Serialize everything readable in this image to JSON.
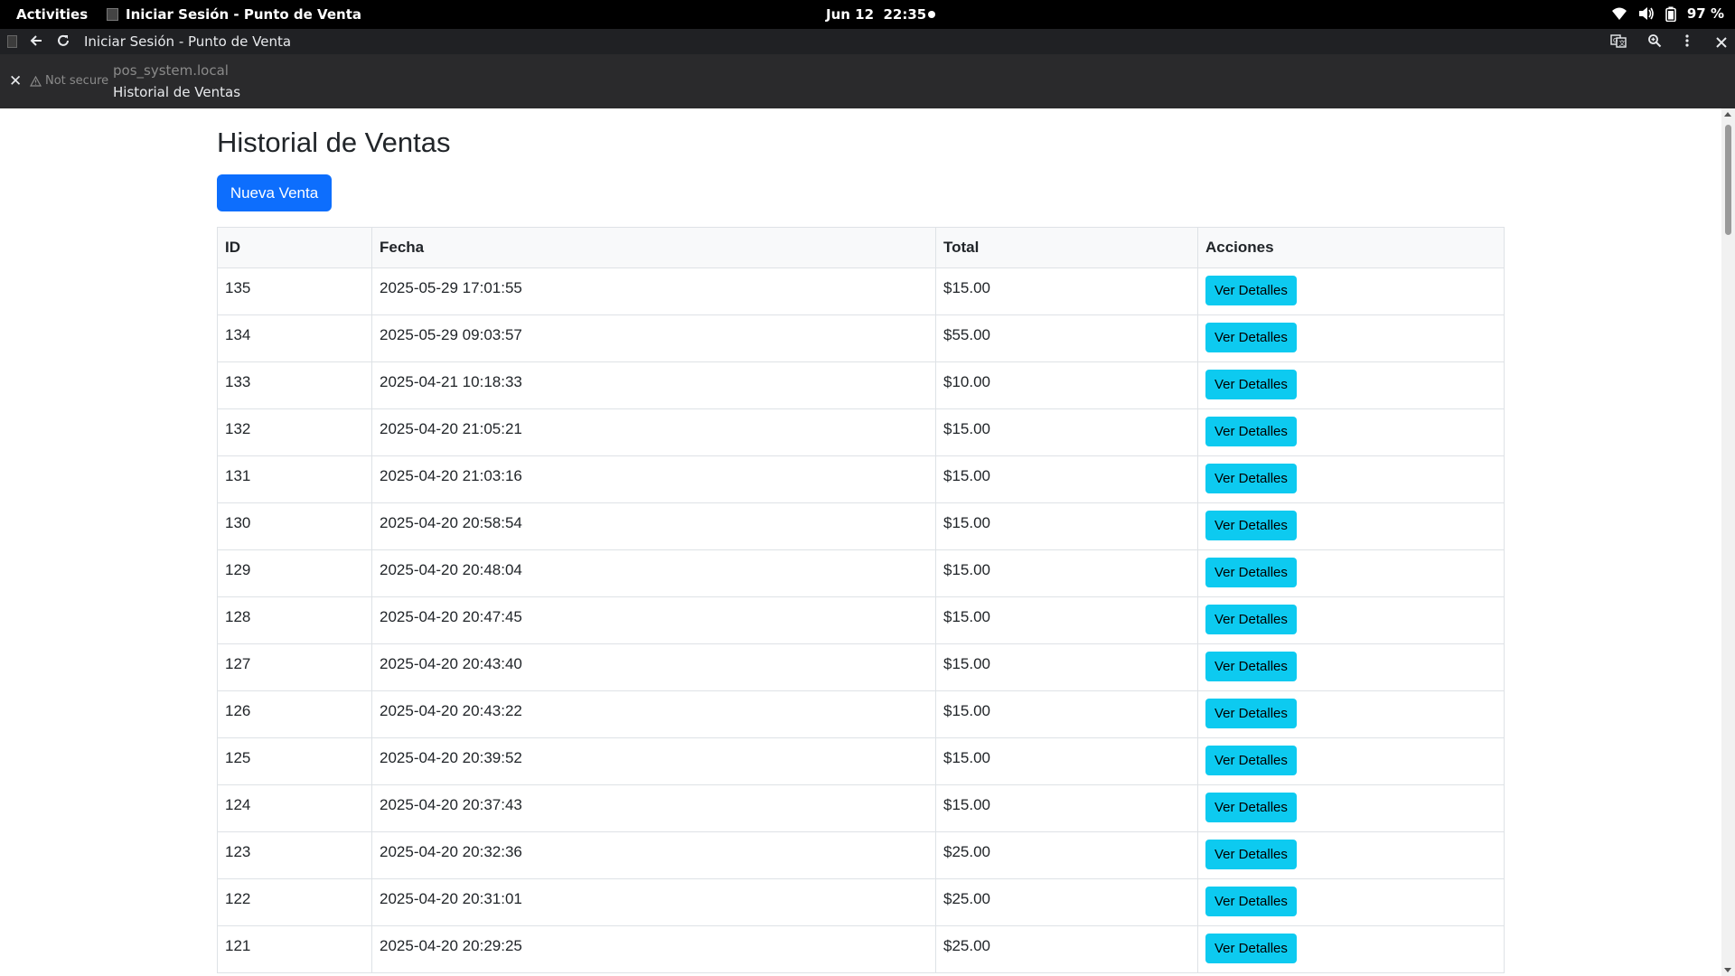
{
  "system_bar": {
    "activities": "Activities",
    "app_name": "Iniciar Sesión - Punto de Venta",
    "date": "Jun 12",
    "time": "22:35",
    "battery": "97 %"
  },
  "browser": {
    "window_title": "Iniciar Sesión - Punto de Venta",
    "security": "Not secure",
    "host": "pos_system.local",
    "page_title": "Historial de Ventas"
  },
  "page": {
    "heading": "Historial de Ventas",
    "new_sale_button": "Nueva Venta",
    "table": {
      "headers": [
        "ID",
        "Fecha",
        "Total",
        "Acciones"
      ],
      "action_label": "Ver Detalles",
      "rows": [
        {
          "id": "135",
          "fecha": "2025-05-29 17:01:55",
          "total": "$15.00"
        },
        {
          "id": "134",
          "fecha": "2025-05-29 09:03:57",
          "total": "$55.00"
        },
        {
          "id": "133",
          "fecha": "2025-04-21 10:18:33",
          "total": "$10.00"
        },
        {
          "id": "132",
          "fecha": "2025-04-20 21:05:21",
          "total": "$15.00"
        },
        {
          "id": "131",
          "fecha": "2025-04-20 21:03:16",
          "total": "$15.00"
        },
        {
          "id": "130",
          "fecha": "2025-04-20 20:58:54",
          "total": "$15.00"
        },
        {
          "id": "129",
          "fecha": "2025-04-20 20:48:04",
          "total": "$15.00"
        },
        {
          "id": "128",
          "fecha": "2025-04-20 20:47:45",
          "total": "$15.00"
        },
        {
          "id": "127",
          "fecha": "2025-04-20 20:43:40",
          "total": "$15.00"
        },
        {
          "id": "126",
          "fecha": "2025-04-20 20:43:22",
          "total": "$15.00"
        },
        {
          "id": "125",
          "fecha": "2025-04-20 20:39:52",
          "total": "$15.00"
        },
        {
          "id": "124",
          "fecha": "2025-04-20 20:37:43",
          "total": "$15.00"
        },
        {
          "id": "123",
          "fecha": "2025-04-20 20:32:36",
          "total": "$25.00"
        },
        {
          "id": "122",
          "fecha": "2025-04-20 20:31:01",
          "total": "$25.00"
        },
        {
          "id": "121",
          "fecha": "2025-04-20 20:29:25",
          "total": "$25.00"
        }
      ]
    }
  },
  "colors": {
    "primary": "#0d6efd",
    "info": "#0dcaf0",
    "table_border": "#dee2e6"
  }
}
